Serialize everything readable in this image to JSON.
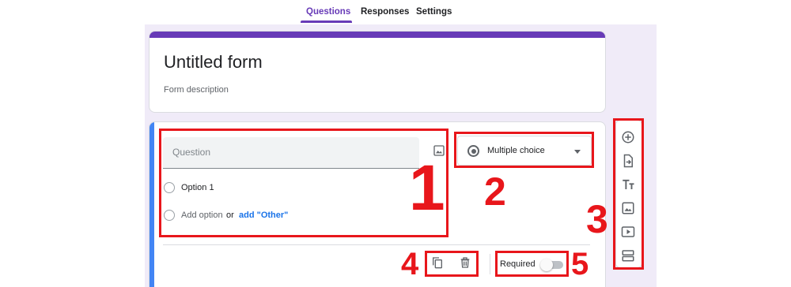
{
  "tabs": {
    "questions": "Questions",
    "responses": "Responses",
    "settings": "Settings"
  },
  "form": {
    "title": "Untitled form",
    "description": "Form description"
  },
  "question": {
    "placeholder": "Question",
    "options": [
      "Option 1"
    ],
    "add_option": "Add option",
    "or": "or",
    "add_other": "add \"Other\"",
    "type": "Multiple choice",
    "required_label": "Required",
    "required": false
  },
  "annotations": [
    "1",
    "2",
    "3",
    "4",
    "5"
  ],
  "colors": {
    "accent": "#673ab7",
    "canvas": "#f0ebf8",
    "active_question": "#4285f4",
    "link": "#1a73e8",
    "annotation": "#e8161b"
  },
  "icons": {
    "toolbar": [
      "add-question-icon",
      "import-questions-icon",
      "add-title-icon",
      "add-image-icon",
      "add-video-icon",
      "add-section-icon"
    ],
    "footer": [
      "duplicate-icon",
      "delete-icon"
    ]
  }
}
